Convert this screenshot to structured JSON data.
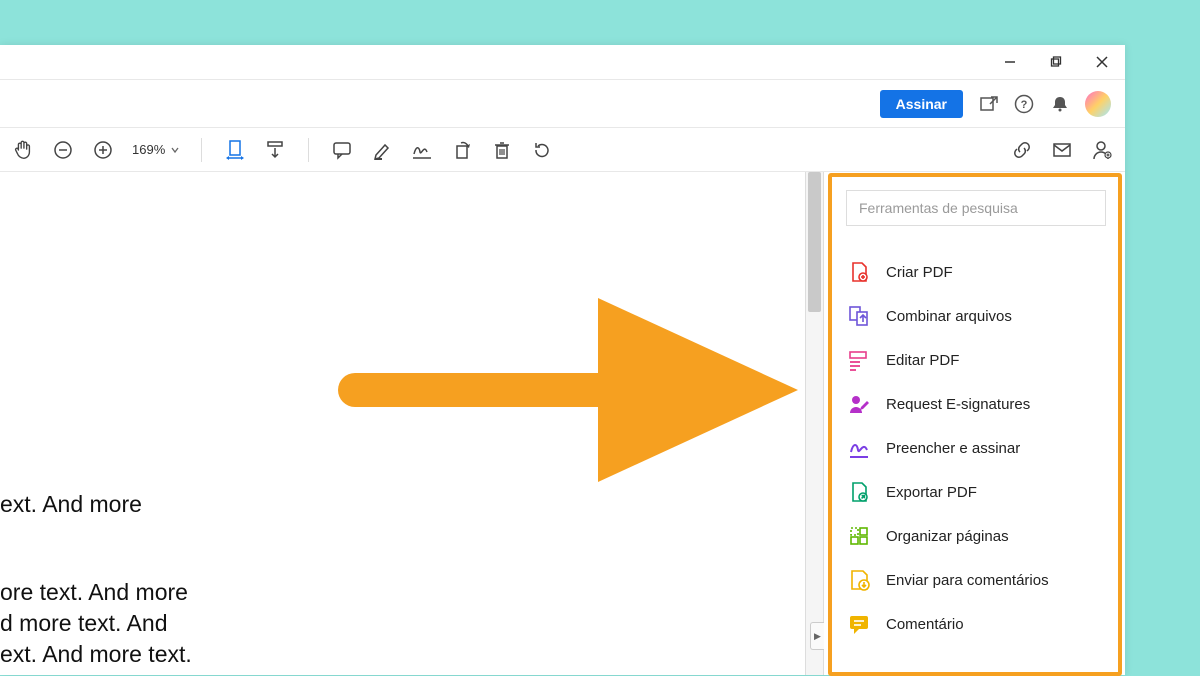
{
  "titlebar": {},
  "topbar": {
    "sign_label": "Assinar"
  },
  "toolbar": {
    "zoom_value": "169%"
  },
  "document": {
    "line1": "ext. And more",
    "line2": "ore text. And more",
    "line3": "d more text. And",
    "line4": "ext. And more text."
  },
  "sidepanel": {
    "search_placeholder": "Ferramentas de pesquisa",
    "tools": [
      {
        "label": "Criar PDF",
        "icon": "create-pdf",
        "color": "#E8322C"
      },
      {
        "label": "Combinar arquivos",
        "icon": "combine",
        "color": "#6E55D9"
      },
      {
        "label": "Editar PDF",
        "icon": "edit-pdf",
        "color": "#E83E8C"
      },
      {
        "label": "Request E-signatures",
        "icon": "request-sign",
        "color": "#B530C9"
      },
      {
        "label": "Preencher e assinar",
        "icon": "fill-sign",
        "color": "#7B3FE4"
      },
      {
        "label": "Exportar PDF",
        "icon": "export-pdf",
        "color": "#00A06B"
      },
      {
        "label": "Organizar páginas",
        "icon": "organize",
        "color": "#5FB800"
      },
      {
        "label": "Enviar para comentários",
        "icon": "send-comments",
        "color": "#F0B400"
      },
      {
        "label": "Comentário",
        "icon": "comment",
        "color": "#F0B400"
      }
    ]
  },
  "annotation": {
    "arrow_color": "#F6A020"
  }
}
